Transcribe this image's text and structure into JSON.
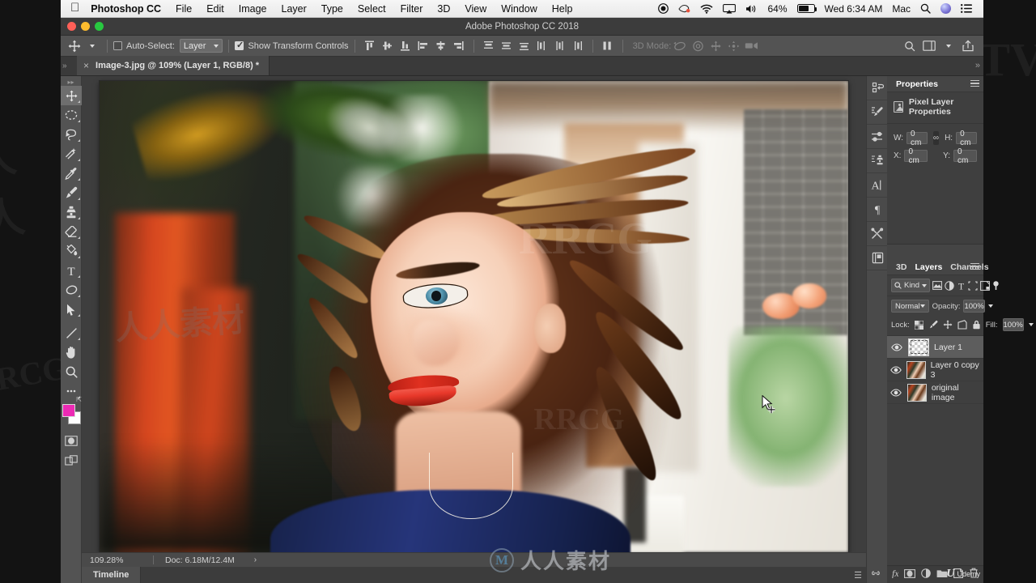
{
  "menubar": {
    "apple_icon": "apple-icon",
    "app_name": "Photoshop CC",
    "items": [
      "File",
      "Edit",
      "Image",
      "Layer",
      "Type",
      "Select",
      "Filter",
      "3D",
      "View",
      "Window",
      "Help"
    ],
    "status": {
      "record_icon": "record-icon",
      "dropbox_icon": "dropbox-icon",
      "wifi_icon": "wifi-icon",
      "airplay_icon": "airplay-icon",
      "volume_icon": "volume-icon",
      "battery_percent": "64%",
      "battery_icon": "battery-icon",
      "clock": "Wed 6:34 AM",
      "user": "Mac",
      "search_icon": "search-icon",
      "siri_icon": "siri-icon",
      "control_center_icon": "control-center-icon"
    }
  },
  "window": {
    "title": "Adobe Photoshop CC 2018",
    "close_label": "close",
    "minimize_label": "minimize",
    "zoom_label": "zoom"
  },
  "options_bar": {
    "tool_icon": "move-tool-icon",
    "tool_preset_caret": "chevron-down-icon",
    "auto_select_checked": false,
    "auto_select_label": "Auto-Select:",
    "auto_select_value": "Layer",
    "show_transform_checked": true,
    "show_transform_label": "Show Transform Controls",
    "align_icons": [
      "align-top-edges-icon",
      "align-vertical-centers-icon",
      "align-bottom-edges-icon",
      "align-left-edges-icon",
      "align-horizontal-centers-icon",
      "align-right-edges-icon"
    ],
    "distribute_icons": [
      "distribute-top-icon",
      "distribute-vertical-center-icon",
      "distribute-bottom-icon",
      "distribute-left-icon",
      "distribute-horizontal-center-icon",
      "distribute-right-icon",
      "distribute-spacing-icon"
    ],
    "mode_3d_label": "3D Mode:",
    "mode_3d_icons": [
      "rotate-3d-icon",
      "roll-3d-icon",
      "drag-3d-icon",
      "slide-3d-icon",
      "scale-3d-icon"
    ],
    "right_icons": [
      "search-icon",
      "workspace-icon",
      "chevron-down-icon",
      "share-icon"
    ]
  },
  "document_tab": {
    "close_icon": "close-icon",
    "title": "Image-3.jpg @ 109% (Layer 1, RGB/8) *"
  },
  "toolbox": {
    "handle_icon": "panel-handle-icon",
    "tools": [
      {
        "name": "move-tool",
        "selected": true
      },
      {
        "name": "elliptical-marquee-tool",
        "selected": false
      },
      {
        "name": "lasso-tool",
        "selected": false
      },
      {
        "name": "quick-selection-tool",
        "selected": false
      },
      {
        "name": "eyedropper-tool",
        "selected": false
      },
      {
        "name": "brush-tool",
        "selected": false
      },
      {
        "name": "clone-stamp-tool",
        "selected": false
      },
      {
        "name": "eraser-tool",
        "selected": false
      },
      {
        "name": "paint-bucket-tool",
        "selected": false
      },
      {
        "name": "type-tool",
        "selected": false
      },
      {
        "name": "ellipse-tool",
        "selected": false
      },
      {
        "name": "path-selection-tool",
        "selected": false
      },
      {
        "name": "line-tool",
        "selected": false
      },
      {
        "name": "hand-tool",
        "selected": false
      },
      {
        "name": "zoom-tool",
        "selected": false
      },
      {
        "name": "edit-toolbar-tool",
        "selected": false
      }
    ],
    "foreground_color": "#ec2ab4",
    "background_color": "#ffffff",
    "swap_icon": "swap-colors-icon",
    "default_colors_icon": "default-colors-icon",
    "quick_mask_icon": "quick-mask-icon",
    "screen_mode_icon": "screen-mode-icon"
  },
  "canvas": {
    "artwork_description": "Painterly stylized portrait of a smiling woman with long brown hair, red lips, blue top, outdoor garden background",
    "watermarks": [
      "RRCG",
      "人人素材",
      "RRCG"
    ],
    "center_watermark_text": "人人素材",
    "center_watermark_mark": "M"
  },
  "status_bar": {
    "zoom": "109.28%",
    "doc_info": "Doc: 6.18M/12.4M",
    "expand_icon": "chevron-right-icon"
  },
  "timeline": {
    "tab_label": "Timeline",
    "menu_icon": "panel-menu-icon"
  },
  "dock_icons": [
    "history-icon",
    "brush-settings-icon",
    "adjustments-icon",
    "clone-source-icon",
    "character-icon",
    "paragraph-icon",
    "tool-presets-icon",
    "libraries-icon"
  ],
  "properties_panel": {
    "tab_label": "Properties",
    "menu_icon": "panel-menu-icon",
    "layer_icon": "pixel-layer-icon",
    "heading": "Pixel Layer Properties",
    "fields": [
      {
        "label": "W:",
        "value": "0 cm",
        "name": "width-field"
      },
      {
        "label": "H:",
        "value": "0 cm",
        "name": "height-field"
      },
      {
        "label": "X:",
        "value": "0 cm",
        "name": "x-field"
      },
      {
        "label": "Y:",
        "value": "0 cm",
        "name": "y-field"
      }
    ],
    "link_icon": "link-dimensions-icon"
  },
  "layers_panel": {
    "tabs": [
      {
        "label": "3D",
        "active": false
      },
      {
        "label": "Layers",
        "active": true
      },
      {
        "label": "Channels",
        "active": false
      }
    ],
    "menu_icon": "panel-menu-icon",
    "filter": {
      "search_icon": "search-icon",
      "kind_label": "Kind",
      "caret_icon": "chevron-down-icon",
      "type_icons": [
        "filter-pixel-icon",
        "filter-adjustment-icon",
        "filter-type-icon",
        "filter-shape-icon",
        "filter-smart-object-icon"
      ],
      "toggle_icon": "filter-toggle-icon"
    },
    "blend_mode": "Normal",
    "blend_caret": "chevron-down-icon",
    "opacity_label": "Opacity:",
    "opacity_value": "100%",
    "lock_label": "Lock:",
    "lock_icons": [
      "lock-transparent-pixels-icon",
      "lock-image-pixels-icon",
      "lock-position-icon",
      "lock-artboard-icon",
      "lock-all-icon"
    ],
    "fill_label": "Fill:",
    "fill_value": "100%",
    "layers": [
      {
        "name": "Layer 1",
        "visible": true,
        "selected": true,
        "thumb": "empty"
      },
      {
        "name": "Layer 0 copy 3",
        "visible": true,
        "selected": false,
        "thumb": "portrait"
      },
      {
        "name": "original image",
        "visible": true,
        "selected": false,
        "thumb": "portrait"
      }
    ],
    "bottom_icons": [
      "link-layers-icon",
      "layer-style-icon",
      "layer-mask-icon",
      "new-adjustment-layer-icon",
      "new-group-icon",
      "new-layer-icon",
      "delete-layer-icon"
    ]
  },
  "branding": {
    "udemy_mark": "U",
    "udemy_label": "Udemy"
  }
}
